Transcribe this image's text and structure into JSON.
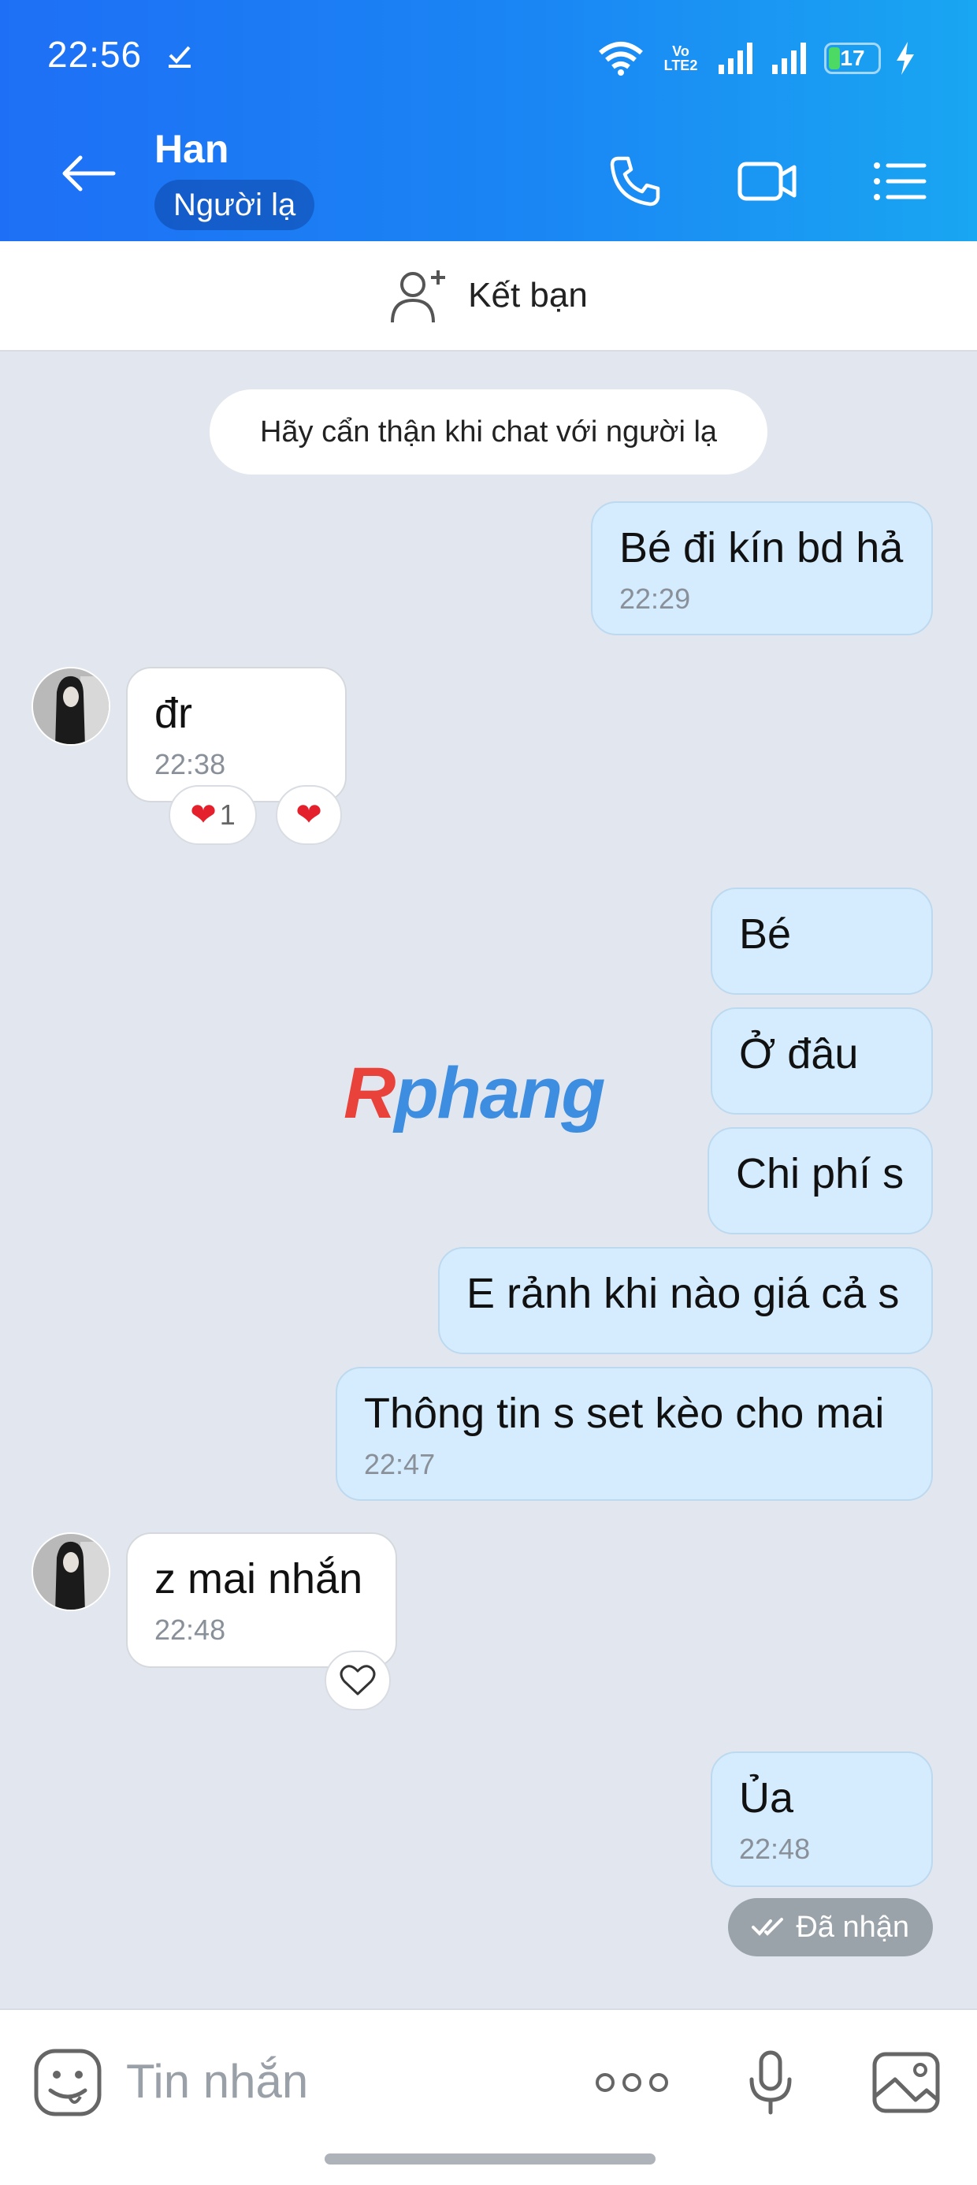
{
  "status_bar": {
    "time": "22:56",
    "network": "Vo LTE2",
    "battery": "17"
  },
  "header": {
    "contact_name": "Han",
    "badge": "Người lạ"
  },
  "add_friend": {
    "label": "Kết bạn"
  },
  "notice": "Hãy cẩn thận khi chat với người lạ",
  "messages": [
    {
      "direction": "out",
      "text": "Bé đi kín bd hả",
      "time": "22:29"
    },
    {
      "direction": "in",
      "text": "đr",
      "time": "22:38",
      "reactions": {
        "count": "1"
      }
    },
    {
      "direction": "out",
      "text": "Bé"
    },
    {
      "direction": "out",
      "text": "Ở đâu"
    },
    {
      "direction": "out",
      "text": "Chi phí s"
    },
    {
      "direction": "out",
      "text": "E rảnh khi nào giá cả s"
    },
    {
      "direction": "out",
      "text": "Thông tin s set kèo cho mai",
      "time": "22:47"
    },
    {
      "direction": "in",
      "text": "z mai nhắn",
      "time": "22:48"
    },
    {
      "direction": "out",
      "text": "Ủa",
      "time": "22:48"
    }
  ],
  "delivery_status": "Đã nhận",
  "watermark": {
    "part1": "R",
    "part2": "phang"
  },
  "input": {
    "placeholder": "Tin nhắn"
  },
  "colors": {
    "header_start": "#1e6ff5",
    "header_end": "#19a6f2",
    "outgoing_bubble": "#d4ecfd",
    "background": "#e2e7ef"
  }
}
